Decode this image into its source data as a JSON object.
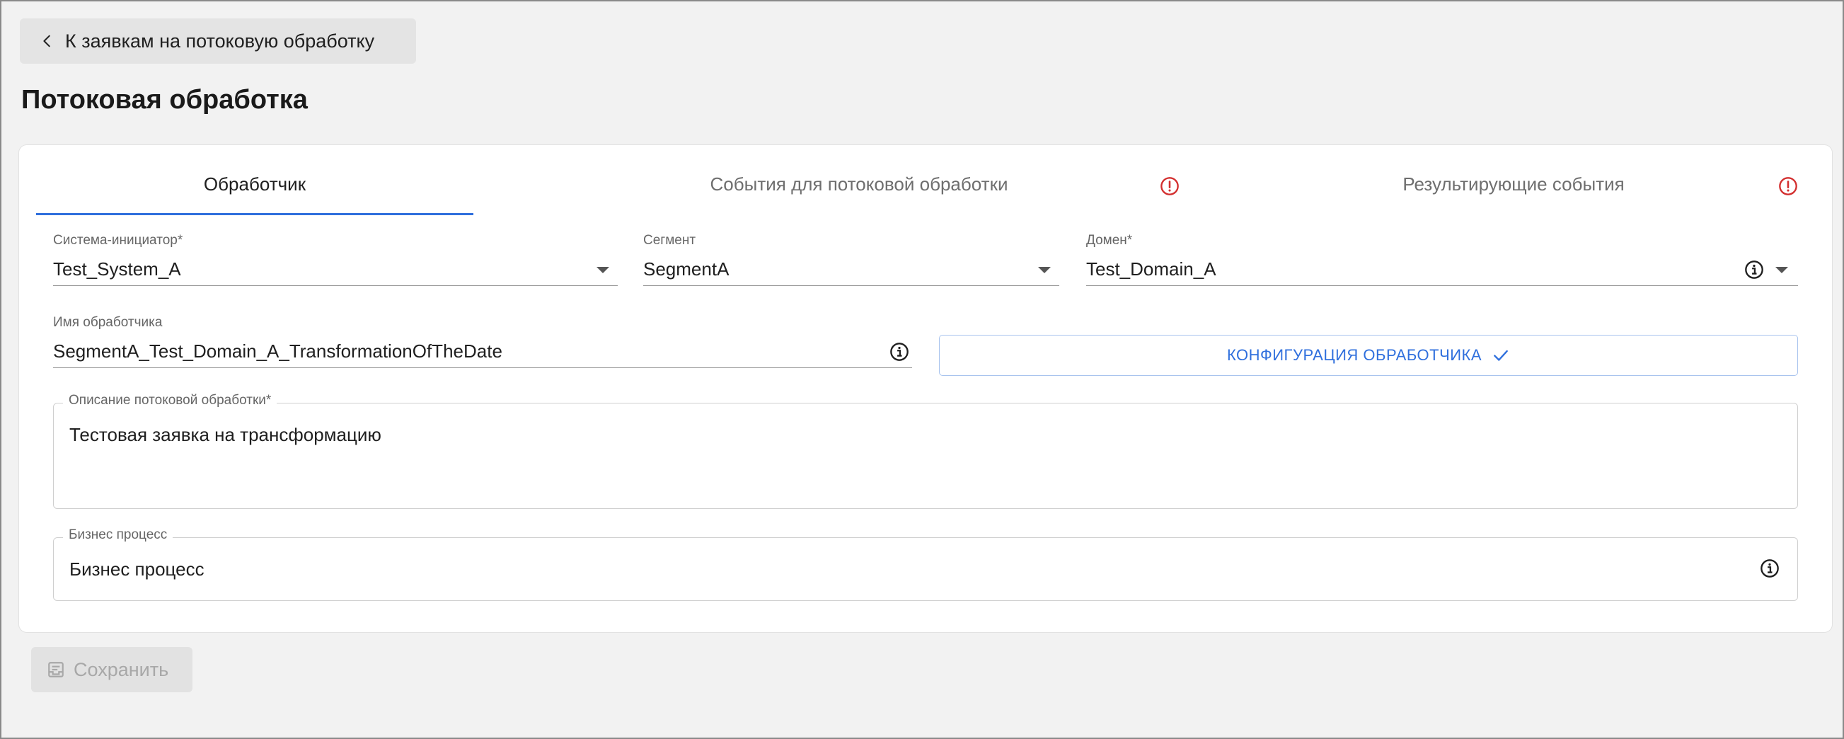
{
  "back_link": {
    "label": "К заявкам на потоковую обработку"
  },
  "page_title": "Потоковая обработка",
  "tabs": [
    {
      "label": "Обработчик",
      "active": true,
      "warning": false
    },
    {
      "label": "События для потоковой обработки",
      "active": false,
      "warning": true
    },
    {
      "label": "Результирующие события",
      "active": false,
      "warning": true
    }
  ],
  "fields": {
    "initiator_system": {
      "label": "Система-инициатор",
      "required_mark": "*",
      "value": "Test_System_A"
    },
    "segment": {
      "label": "Сегмент",
      "value": "SegmentA"
    },
    "domain": {
      "label": "Домен",
      "required_mark": "*",
      "value": "Test_Domain_A"
    },
    "handler_name": {
      "label": "Имя обработчика",
      "value": "SegmentA_Test_Domain_A_TransformationOfTheDate"
    },
    "description": {
      "label": "Описание потоковой обработки",
      "required_mark": "*",
      "value": "Тестовая заявка на трансформацию"
    },
    "business_process": {
      "label": "Бизнес процесс",
      "value": "Бизнес процесс"
    }
  },
  "config_button": {
    "label": "КОНФИГУРАЦИЯ ОБРАБОТЧИКА",
    "icon": "check-icon"
  },
  "save_button": {
    "label": "Сохранить",
    "icon": "save-icon",
    "disabled": true
  },
  "colors": {
    "accent": "#2f6fdd",
    "warning": "#d32f2f",
    "background": "#f2f2f2"
  }
}
